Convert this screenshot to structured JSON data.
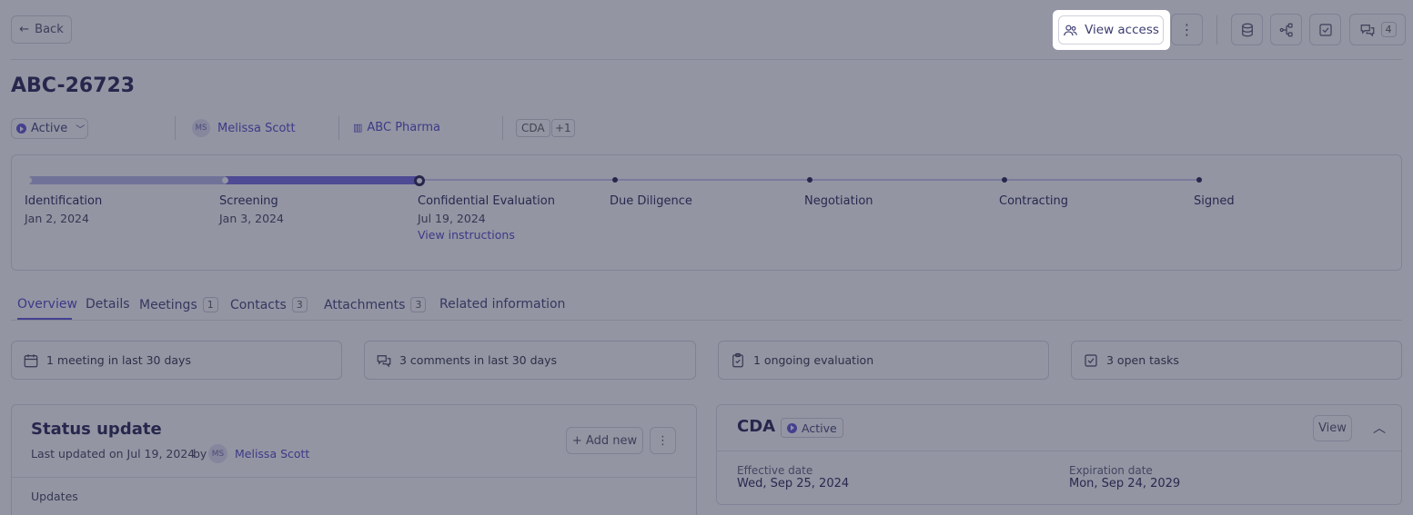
{
  "header": {
    "back_label": "Back",
    "view_access_label": "View access",
    "comments_count": "4"
  },
  "record": {
    "title": "ABC-26723",
    "status": "Active",
    "owner_initials": "MS",
    "owner_name": "Melissa Scott",
    "company": "ABC Pharma",
    "tag": "CDA",
    "tag_more": "+1"
  },
  "stages": [
    {
      "label": "Identification",
      "date": "Jan 2, 2024"
    },
    {
      "label": "Screening",
      "date": "Jan 3, 2024"
    },
    {
      "label": "Confidential Evaluation",
      "date": "Jul 19, 2024",
      "link": "View instructions"
    },
    {
      "label": "Due Diligence"
    },
    {
      "label": "Negotiation"
    },
    {
      "label": "Contracting"
    },
    {
      "label": "Signed"
    }
  ],
  "tabs": [
    {
      "label": "Overview"
    },
    {
      "label": "Details"
    },
    {
      "label": "Meetings",
      "count": "1"
    },
    {
      "label": "Contacts",
      "count": "3"
    },
    {
      "label": "Attachments",
      "count": "3"
    },
    {
      "label": "Related information"
    }
  ],
  "summary": [
    {
      "icon": "calendar-icon",
      "text": "1 meeting in last 30 days"
    },
    {
      "icon": "comments-icon",
      "text": "3 comments in last 30 days"
    },
    {
      "icon": "clipboard-icon",
      "text": "1 ongoing evaluation"
    },
    {
      "icon": "checkbox-icon",
      "text": "3 open tasks"
    }
  ],
  "status_update": {
    "title": "Status update",
    "updated_prefix": "Last updated on Jul 19, 2024",
    "by": "by",
    "author_initials": "MS",
    "author_name": "Melissa Scott",
    "add_new_label": "+ Add new",
    "updates_label": "Updates"
  },
  "cda": {
    "title": "CDA",
    "status": "Active",
    "view_label": "View",
    "effective_label": "Effective date",
    "effective_value": "Wed, Sep 25, 2024",
    "expiration_label": "Expiration date",
    "expiration_value": "Mon, Sep 24, 2029"
  },
  "colors": {
    "accent": "#5b4fd6",
    "overlay": "#30344e"
  }
}
